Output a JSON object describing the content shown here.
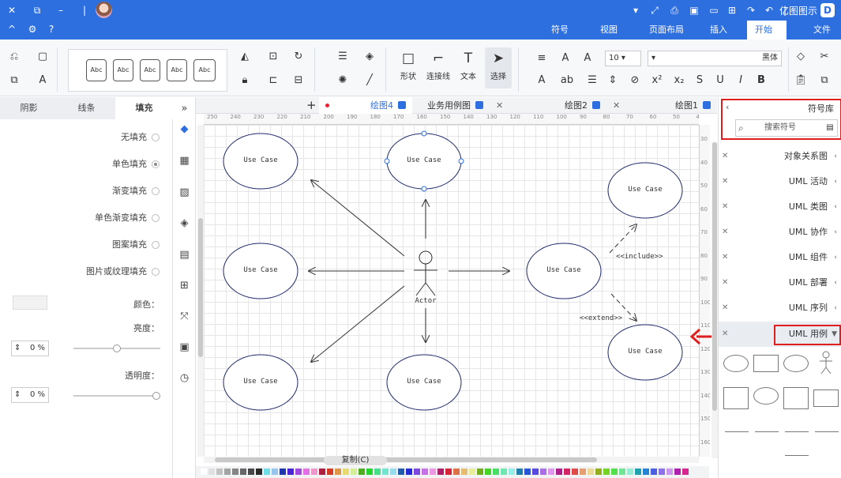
{
  "titlebar": {
    "app_name": "亿图图示",
    "menu_tabs": [
      "文件",
      "开始",
      "插入",
      "页面布局",
      "视图",
      "符号"
    ],
    "active_tab": "开始",
    "share_label": "分享",
    "publish_label": "发布"
  },
  "ribbon": {
    "font_name": "黑体",
    "font_size": "10",
    "big_buttons": [
      "选择",
      "文本",
      "连接线",
      "形状"
    ],
    "style_samples": [
      "Abc",
      "Abc",
      "Abc",
      "Abc",
      "Abc",
      "Abc"
    ]
  },
  "left_panel": {
    "tabs": [
      "填充",
      "线条",
      "阴影"
    ],
    "fill_options": [
      "无填充",
      "单色填充",
      "渐变填充",
      "单色渐变填充",
      "图案填充",
      "图片或纹理填充"
    ],
    "selected_fill": "单色填充",
    "color_label": "颜色：",
    "brightness_label": "亮度：",
    "brightness_value": "0 %",
    "transparency_label": "透明度：",
    "transparency_value": "0 %"
  },
  "doc_tabs": [
    {
      "label": "绘图1"
    },
    {
      "label": "绘图2"
    },
    {
      "label": "业务用例图"
    },
    {
      "label": "绘图4",
      "active": true,
      "modified": true
    }
  ],
  "ruler": {
    "h": [
      "250",
      "240",
      "230",
      "220",
      "210",
      "200",
      "190",
      "180",
      "170",
      "160",
      "150",
      "140",
      "130",
      "120",
      "110",
      "100",
      "90",
      "80",
      "70",
      "60",
      "50",
      "40",
      "30"
    ],
    "v": [
      "30",
      "40",
      "50",
      "60",
      "70",
      "80",
      "90",
      "100",
      "110",
      "120",
      "130",
      "140",
      "150",
      "160"
    ]
  },
  "diagram": {
    "use_case_label": "Use Case",
    "actor_label": "Actor",
    "include_label": "<<include>>",
    "extend_label": "<<extend>>"
  },
  "canvas_label": "复制(C)",
  "right_panel": {
    "title": "符号库",
    "search_placeholder": "搜索符号",
    "categories": [
      "对象关系图",
      "UML 活动",
      "UML 类图",
      "UML 协作",
      "UML 组件",
      "UML 部署",
      "UML 序列",
      "UML 用例"
    ],
    "open_category": "UML 用例"
  },
  "colors": {
    "brand": "#2e6fe0",
    "highlight_red": "#e01e1e"
  }
}
